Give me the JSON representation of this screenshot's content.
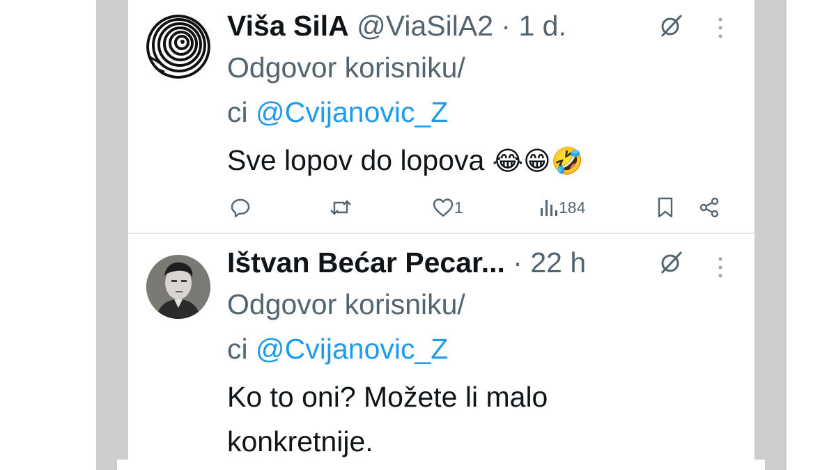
{
  "colors": {
    "text_primary": "#0f1419",
    "text_secondary": "#536471",
    "link": "#1d9bf0",
    "side_band": "#cfcccf"
  },
  "tweets": [
    {
      "display_name": "Viša SilA",
      "handle": "@ViaSilA2",
      "separator": "·",
      "time": "1 d.",
      "reply_prefix_1": "Odgovor korisniku/",
      "reply_prefix_2": "ci",
      "reply_mention": "@Cvijanovic_Z",
      "text_line_1": "Sve lopov do lopova",
      "emojis": "😂😁🤣",
      "likes": "1",
      "views": "184",
      "icons": [
        "avatar-spiral",
        "grok-icon",
        "more-icon",
        "reply-icon",
        "retweet-icon",
        "like-icon",
        "views-icon",
        "bookmark-icon",
        "share-icon"
      ]
    },
    {
      "display_name": "Ištvan Bećar Pecar...",
      "separator": "·",
      "time": "22 h",
      "reply_prefix_1": "Odgovor korisniku/",
      "reply_prefix_2": "ci",
      "reply_mention": "@Cvijanovic_Z",
      "text_line_1": "Ko to oni? Možete li malo",
      "text_line_2": "konkretnije.",
      "icons": [
        "avatar-photo",
        "grok-icon",
        "more-icon"
      ]
    }
  ]
}
